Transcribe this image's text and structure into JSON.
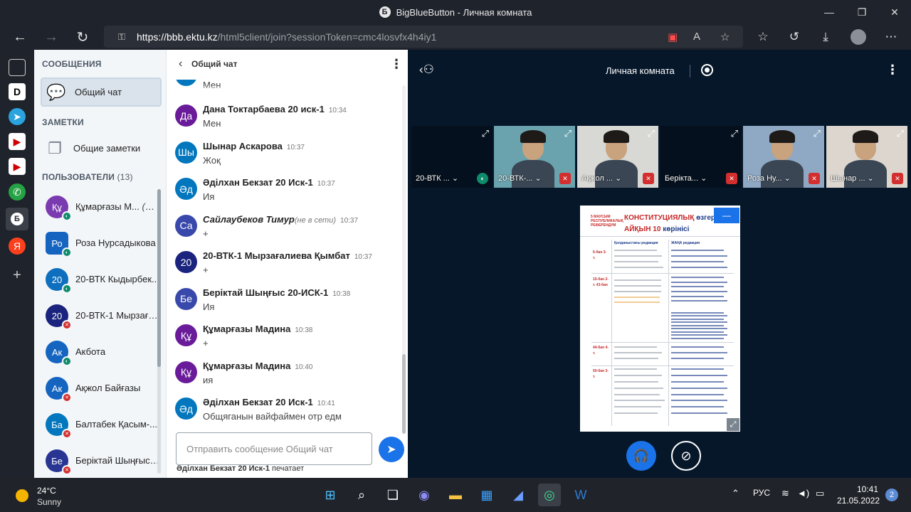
{
  "window": {
    "title": "BigBlueButton - Личная комната",
    "logo_letter": "Б",
    "min": "—",
    "max": "❐",
    "close": "✕"
  },
  "browser": {
    "url_host": "https://bbb.ektu.kz",
    "url_path": "/html5client/join?sessionToken=cmc4losvfx4h4iy1",
    "back_icon": "←",
    "forward_icon": "→",
    "reload_icon": "↻",
    "lock_icon": "🔒"
  },
  "sidebar_icons": [
    "▣",
    "D",
    "➤",
    "▶",
    "▶",
    "✆",
    "Б",
    "Я",
    "+"
  ],
  "userpanel": {
    "messages_title": "СООБЩЕНИЯ",
    "public_chat": "Общий чат",
    "notes_title": "ЗАМЕТКИ",
    "shared_notes": "Общие заметки",
    "users_title": "ПОЛЬЗОВАТЕЛИ",
    "users_count": "(13)",
    "users": [
      {
        "initials": "Құ",
        "name": "Құмарғазы М...",
        "suffix": "(Вы)",
        "color": "#7b3bb0",
        "status": "listen"
      },
      {
        "initials": "Ро",
        "name": "Роза Нурсадыкова",
        "suffix": "",
        "color": "#1565c0",
        "status": "listen"
      },
      {
        "initials": "20",
        "name": "20-ВТК Кыдырбек...",
        "suffix": "",
        "color": "#0d6fbe",
        "status": "listen"
      },
      {
        "initials": "20",
        "name": "20-ВТК-1 Мырзаға...",
        "suffix": "",
        "color": "#1a237e",
        "status": "mute"
      },
      {
        "initials": "Ак",
        "name": "Акбота",
        "suffix": "",
        "color": "#1565c0",
        "status": "listen"
      },
      {
        "initials": "Ак",
        "name": "Ақжол Байғазы",
        "suffix": "",
        "color": "#1565c0",
        "status": "mute"
      },
      {
        "initials": "Ба",
        "name": "Балтабек Қасым-...",
        "suffix": "",
        "color": "#0277bd",
        "status": "mute"
      },
      {
        "initials": "Бе",
        "name": "Берiктай Шыңғыс ...",
        "suffix": "",
        "color": "#283593",
        "status": "mute"
      }
    ]
  },
  "chat": {
    "title": "Общий чат",
    "partial_text": "Мен",
    "messages": [
      {
        "initials": "Да",
        "name": "Дана Токтарбаева 20 иск-1",
        "offline": "",
        "time": "10:34",
        "text": "Мен",
        "color": "#6a1b9a"
      },
      {
        "initials": "Шы",
        "name": "Шынар Аскарова",
        "offline": "",
        "time": "10:37",
        "text": "Жоқ",
        "color": "#0277bd"
      },
      {
        "initials": "Әд",
        "name": "Әділхан Бекзат 20 Иск-1",
        "offline": "",
        "time": "10:37",
        "text": "Ия",
        "color": "#0277bd"
      },
      {
        "initials": "Са",
        "name": "Сайлаубеков Тимур",
        "offline": "(не в сети)",
        "time": "10:37",
        "text": "+",
        "color": "#3949ab"
      },
      {
        "initials": "20",
        "name": "20-ВТК-1 Мырзағалиева Қымбат",
        "offline": "",
        "time": "10:37",
        "text": "+",
        "color": "#1a237e"
      },
      {
        "initials": "Бе",
        "name": "Берiктай Шыңғыс 20-ИСК-1",
        "offline": "",
        "time": "10:38",
        "text": "Ия",
        "color": "#3949ab"
      },
      {
        "initials": "Құ",
        "name": "Құмарғазы Мадина",
        "offline": "",
        "time": "10:38",
        "text": "+",
        "color": "#6a1b9a"
      },
      {
        "initials": "Құ",
        "name": "Құмарғазы Мадина",
        "offline": "",
        "time": "10:40",
        "text": "ия",
        "color": "#6a1b9a"
      },
      {
        "initials": "Әд",
        "name": "Әділхан Бекзат 20 Иск-1",
        "offline": "",
        "time": "10:41",
        "text": "Общяганын вайфаймен отр едм",
        "color": "#0277bd"
      }
    ],
    "input_placeholder": "Отправить сообщение Общий чат",
    "typing_name": "Әділхан Бекзат 20 Иск-1",
    "typing_suffix": "печатает"
  },
  "room": {
    "name": "Личная комната"
  },
  "videos": [
    {
      "name": "20-ВТК ...",
      "status": "lis",
      "bg": "#04101d"
    },
    {
      "name": "20-ВТК-...",
      "status": "mute",
      "bg": "#6aa3ad"
    },
    {
      "name": "Ақжол ...",
      "status": "mute",
      "bg": "#d8d8d4"
    },
    {
      "name": "Берiкта...",
      "status": "mute",
      "bg": "#04101d"
    },
    {
      "name": "Роза Ну...",
      "status": "mute",
      "bg": "#8fa9c4"
    },
    {
      "name": "Шынар ...",
      "status": "mute",
      "bg": "#dcd6ce"
    }
  ],
  "slide": {
    "left_label": "5 МАУСЫМ РЕСПУБЛИКАЛЫҚ РЕФЕРЕНДУМ",
    "title1": "КОНСТИТУЦИЯЛЫҚ",
    "title1b": "өзгерістер",
    "title2": "АЙҚЫН 10",
    "title2b": "көрінісі",
    "minimize": "—",
    "col1": "Қолданыстағы редакция",
    "col2": "ЖАҢА редакция",
    "rows": [
      "6-бап 3-т.",
      "15-бап 2-т. 43-бап",
      "44-бап 4-т.",
      "50-бап 3-т."
    ]
  },
  "taskbar": {
    "temp": "24°C",
    "cond": "Sunny",
    "lang": "РУС",
    "time": "10:41",
    "date": "21.05.2022",
    "notif": "2"
  }
}
